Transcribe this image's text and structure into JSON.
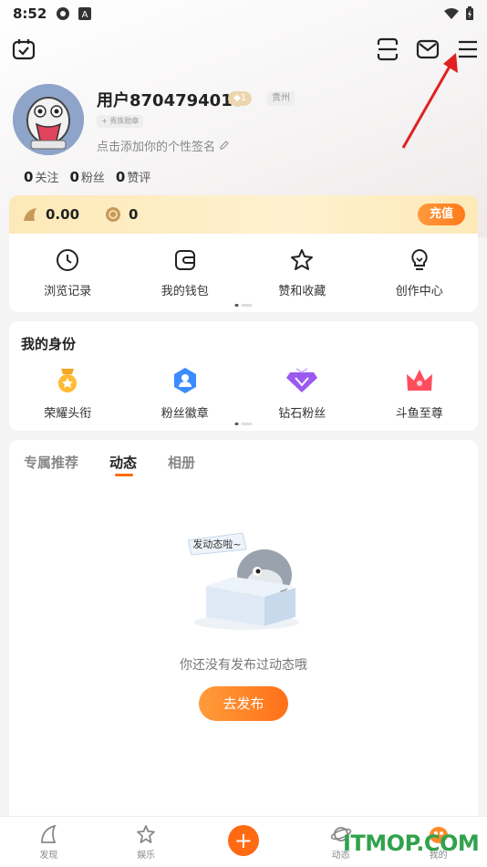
{
  "status_bar": {
    "time": "8:52"
  },
  "profile": {
    "username": "用户8704794018",
    "level": "1",
    "location": "贵州",
    "medal": "+ 贵族勋章",
    "signature": "点击添加你的个性签名"
  },
  "stats": [
    {
      "count": "0",
      "label": "关注"
    },
    {
      "count": "0",
      "label": "粉丝"
    },
    {
      "count": "0",
      "label": "赞评"
    }
  ],
  "wallet": {
    "fish_wings": "0.00",
    "fish_balls": "0",
    "recharge_label": "充值"
  },
  "quick_actions": [
    {
      "label": "浏览记录",
      "icon": "clock-icon"
    },
    {
      "label": "我的钱包",
      "icon": "wallet-icon"
    },
    {
      "label": "赞和收藏",
      "icon": "star-icon"
    },
    {
      "label": "创作中心",
      "icon": "lightbulb-icon"
    }
  ],
  "identity": {
    "title": "我的身份",
    "items": [
      {
        "label": "荣耀头衔",
        "icon": "honor-title-icon"
      },
      {
        "label": "粉丝徽章",
        "icon": "fan-badge-icon"
      },
      {
        "label": "钻石粉丝",
        "icon": "diamond-fan-icon"
      },
      {
        "label": "斗鱼至尊",
        "icon": "crown-icon"
      }
    ]
  },
  "tabs": [
    "专属推荐",
    "动态",
    "相册"
  ],
  "active_tab": "动态",
  "empty_state": {
    "bubble": "发动态啦~",
    "text": "你还没有发布过动态哦",
    "button": "去发布"
  },
  "bottom_nav": [
    {
      "label": "发现",
      "icon": "discover-icon"
    },
    {
      "label": "娱乐",
      "icon": "entertainment-icon"
    },
    {
      "label": "",
      "icon": "plus-icon"
    },
    {
      "label": "动态",
      "icon": "planet-icon"
    },
    {
      "label": "我的",
      "icon": "profile-icon"
    }
  ],
  "watermark": "ITMOP.COM",
  "colors": {
    "accent": "#ff6a13",
    "wallet_bg": "#fde9b8",
    "watermark": "#31a24c"
  }
}
